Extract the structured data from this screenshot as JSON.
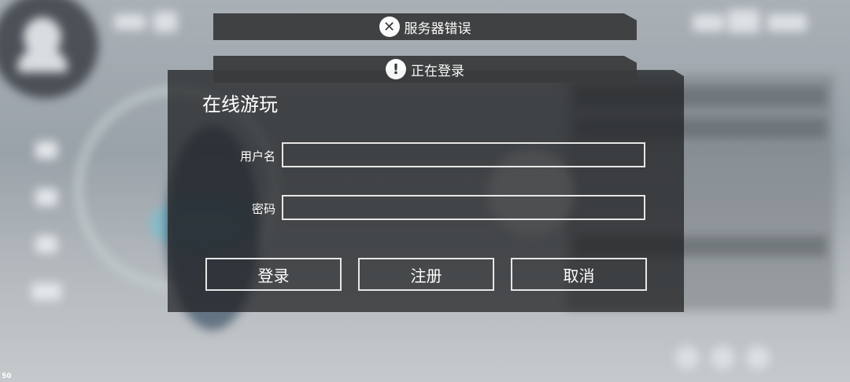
{
  "notifications": {
    "error": {
      "icon": "close-circle-icon",
      "glyph": "✕",
      "text": "服务器错误"
    },
    "info": {
      "icon": "exclamation-circle-icon",
      "glyph": "!",
      "text": "正在登录"
    }
  },
  "dialog": {
    "title": "在线游玩",
    "username_label": "用户名",
    "username_value": "",
    "password_label": "密码",
    "password_value": "",
    "buttons": {
      "login": "登录",
      "register": "注册",
      "cancel": "取消"
    }
  },
  "fps": "50",
  "colors": {
    "notice_bg": "#3a3b3d",
    "dialog_bg": "#1c1d1f",
    "border": "#e6e6e6",
    "text": "#ffffff"
  }
}
